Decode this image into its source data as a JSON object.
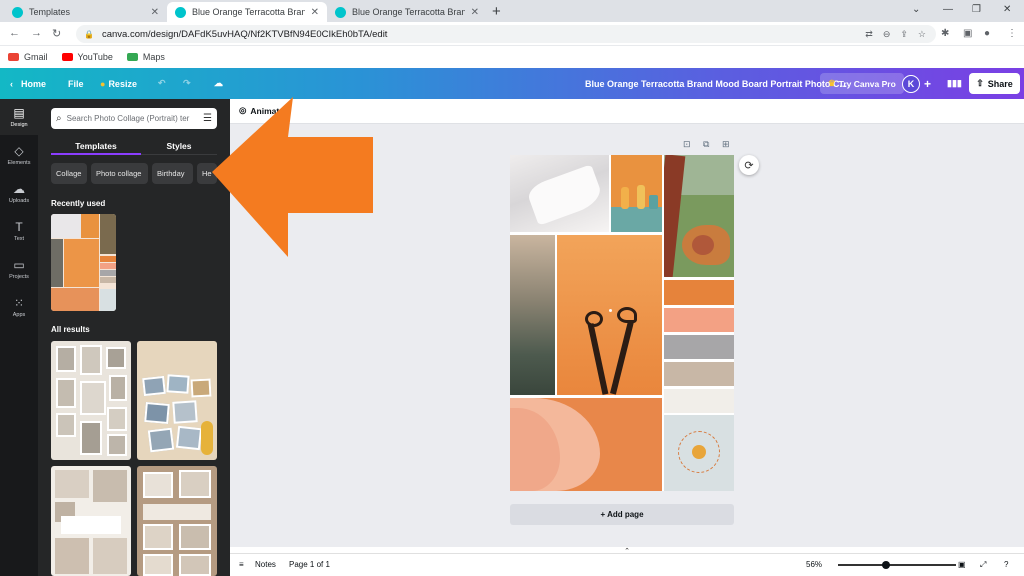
{
  "browser": {
    "tabs": [
      {
        "title": "Templates",
        "active": false
      },
      {
        "title": "Blue Orange Terracotta Brand Mo",
        "active": true
      },
      {
        "title": "Blue Orange Terracotta Brand Mo",
        "active": false
      }
    ],
    "url": "canva.com/design/DAFdK5uvHAQ/Nf2KTVBfN94E0CIkEh0bTA/edit",
    "bookmarks": [
      {
        "label": "Gmail",
        "icon": "gmail-icon",
        "color": "#ea4335"
      },
      {
        "label": "YouTube",
        "icon": "youtube-icon",
        "color": "#ff0000"
      },
      {
        "label": "Maps",
        "icon": "maps-icon",
        "color": "#34a853"
      }
    ]
  },
  "header": {
    "home": "Home",
    "file": "File",
    "resize": "Resize",
    "doc_title": "Blue Orange Terracotta Brand Mood Board Portrait Photo C...",
    "try_pro": "Try Canva Pro",
    "avatar_initial": "K",
    "share": "Share"
  },
  "rail": [
    {
      "label": "Design",
      "icon": "layout-icon",
      "active": true
    },
    {
      "label": "Elements",
      "icon": "shapes-icon",
      "active": false
    },
    {
      "label": "Uploads",
      "icon": "cloud-upload-icon",
      "active": false
    },
    {
      "label": "Text",
      "icon": "text-icon",
      "active": false
    },
    {
      "label": "Projects",
      "icon": "folder-icon",
      "active": false
    },
    {
      "label": "Apps",
      "icon": "grid-icon",
      "active": false
    }
  ],
  "panel": {
    "search_placeholder": "Search Photo Collage (Portrait) ter",
    "tabs": [
      "Templates",
      "Styles"
    ],
    "chips": [
      "Collage",
      "Photo collage",
      "Birthday",
      "He"
    ],
    "recently_used": "Recently used",
    "all_results": "All results"
  },
  "canvas": {
    "animate": "Animate",
    "add_page": "+ Add page",
    "notes": "Notes",
    "page_indicator": "Page 1 of 1",
    "zoom": "56%"
  },
  "colors": {
    "accent": "#8b3dff",
    "terracotta": "#e5843f",
    "swatch1": "#e6833b",
    "swatch2": "#f3a184",
    "swatch3": "#a7a6a8",
    "swatch4": "#c8b7a6",
    "swatch5": "#f1eee9",
    "arrow": "#f47b20"
  }
}
